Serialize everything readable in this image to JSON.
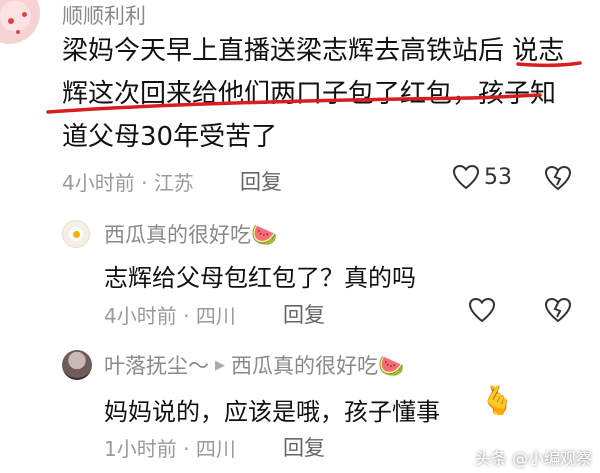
{
  "comment": {
    "username": "顺顺利利",
    "text_lines": [
      "梁妈今天早上直播送梁志辉去高铁站后 说志",
      "辉这次回来给他们两口子包了红包，孩子知",
      "道父母30年受苦了"
    ],
    "time": "4小时前",
    "location": "江苏",
    "reply_label": "回复",
    "likes": "53"
  },
  "replies": [
    {
      "username": "西瓜真的很好吃🍉",
      "reply_to": "",
      "text": "志辉给父母包红包了？真的吗",
      "time": "4小时前",
      "location": "四川",
      "reply_label": "回复"
    },
    {
      "username": "叶落抚尘～",
      "reply_to": "西瓜真的很好吃🍉",
      "text": "妈妈说的，应该是哦，孩子懂事",
      "time": "1小时前",
      "location": "四川",
      "reply_label": "回复"
    }
  ],
  "watermark": "头条 @小编观察",
  "colors": {
    "underline": "#d81e1e",
    "meta": "#9a9a9a"
  }
}
